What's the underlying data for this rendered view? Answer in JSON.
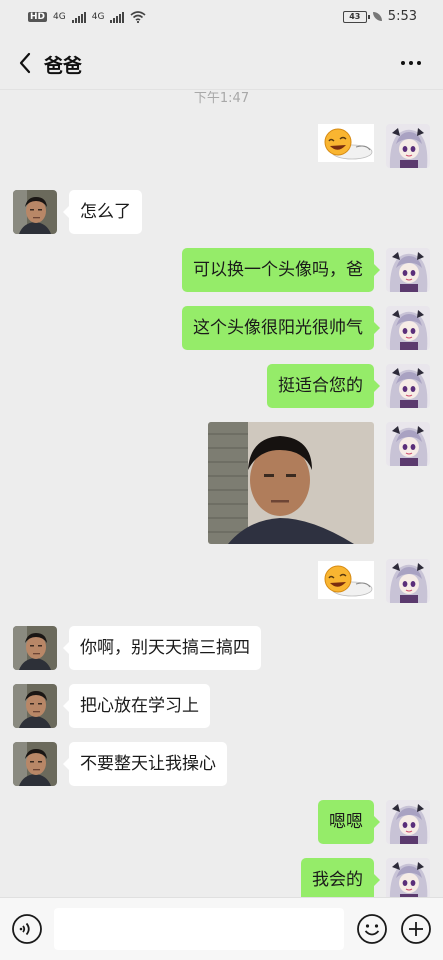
{
  "status_bar": {
    "hd_badge": "HD",
    "network_1": "4G",
    "network_2": "4G",
    "battery": "43",
    "time": "5:53"
  },
  "header": {
    "title": "爸爸",
    "back_icon": "chevron-left-icon",
    "more_icon": "more-dots-icon"
  },
  "chat": {
    "timestamp": "下午1:47",
    "messages": [
      {
        "side": "right",
        "kind": "sticker",
        "sticker": "laughing-blob-sticker"
      },
      {
        "side": "left",
        "kind": "text",
        "text": "怎么了"
      },
      {
        "side": "right",
        "kind": "text",
        "text": "可以换一个头像吗，爸"
      },
      {
        "side": "right",
        "kind": "text",
        "text": "这个头像很阳光很帅气"
      },
      {
        "side": "right",
        "kind": "text",
        "text": "挺适合您的"
      },
      {
        "side": "right",
        "kind": "image",
        "image": "portrait-photo"
      },
      {
        "side": "right",
        "kind": "sticker",
        "sticker": "laughing-blob-sticker"
      },
      {
        "side": "left",
        "kind": "text",
        "text": "你啊，别天天搞三搞四"
      },
      {
        "side": "left",
        "kind": "text",
        "text": "把心放在学习上"
      },
      {
        "side": "left",
        "kind": "text",
        "text": "不要整天让我操心"
      },
      {
        "side": "right",
        "kind": "text",
        "text": "嗯嗯"
      },
      {
        "side": "right",
        "kind": "text",
        "text": "我会的"
      }
    ]
  },
  "input_bar": {
    "value": "",
    "voice_icon": "voice-icon",
    "emoji_icon": "emoji-icon",
    "plus_icon": "plus-icon"
  },
  "colors": {
    "background": "#ededed",
    "self_bubble": "#95ec69",
    "other_bubble": "#ffffff",
    "input_bar": "#f7f7f7"
  }
}
